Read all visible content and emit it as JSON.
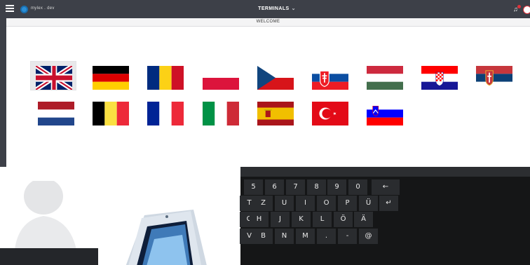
{
  "header": {
    "brand": "mylex . dev",
    "title": "TERMINALS",
    "title_chevron": "⌄",
    "notification_glyph": "♫"
  },
  "subheader": {
    "welcome": "WELCOME"
  },
  "languages": {
    "selected": "united-kingdom",
    "flags": [
      "united-kingdom",
      "germany",
      "romania",
      "poland",
      "czech-republic",
      "slovakia",
      "hungary",
      "croatia",
      "serbia",
      "netherlands",
      "belgium",
      "france",
      "italy",
      "spain",
      "turkey",
      "slovenia"
    ]
  },
  "keyboard": {
    "row1": [
      "5",
      "6",
      "7",
      "8",
      "9",
      "0",
      "←"
    ],
    "row2": [
      "T",
      "Z",
      "U",
      "I",
      "O",
      "P",
      "Ü",
      "↵"
    ],
    "row3": [
      "G",
      "H",
      "J",
      "K",
      "L",
      "Ö",
      "Ä"
    ],
    "row4": [
      "V",
      "B",
      "N",
      "M",
      ".",
      "-",
      "@"
    ]
  }
}
